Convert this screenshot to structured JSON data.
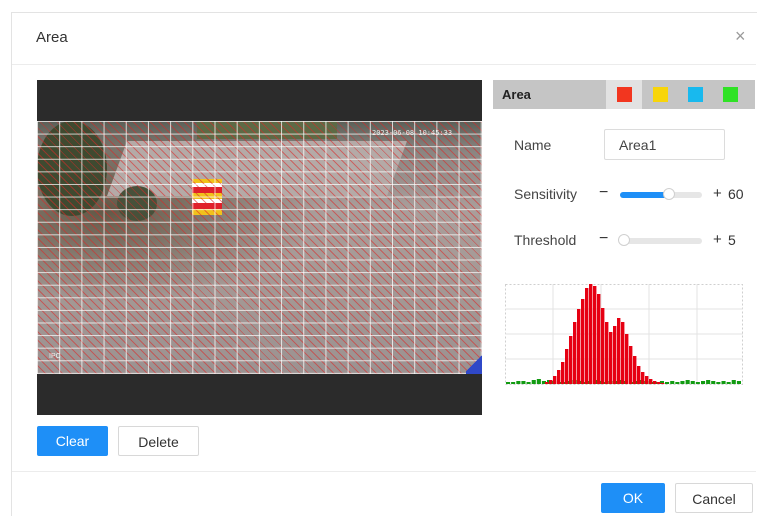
{
  "dialog": {
    "title": "Area",
    "close_glyph": "×"
  },
  "preview": {
    "osd_top_right": "2023-06-08 10:45:33",
    "osd_bottom_left": "IPC"
  },
  "actions": {
    "clear_label": "Clear",
    "delete_label": "Delete"
  },
  "area_panel": {
    "header_label": "Area",
    "colors": [
      {
        "name": "red",
        "hex": "#f2361f",
        "selected": true
      },
      {
        "name": "yellow",
        "hex": "#f8d50a",
        "selected": false
      },
      {
        "name": "blue",
        "hex": "#18b9ee",
        "selected": false
      },
      {
        "name": "green",
        "hex": "#2fe225",
        "selected": false
      }
    ]
  },
  "settings": {
    "name_label": "Name",
    "name_value": "Area1",
    "sensitivity_label": "Sensitivity",
    "sensitivity_value": "60",
    "threshold_label": "Threshold",
    "threshold_value": "5",
    "minus_glyph": "−",
    "plus_glyph": "+"
  },
  "sliders": {
    "sensitivity_fraction": 0.6,
    "threshold_fraction": 0.05
  },
  "histogram": {
    "red_color": "#e60012",
    "green_color": "#129b12",
    "red_bars": [
      0,
      0,
      0,
      2,
      4,
      8,
      14,
      22,
      35,
      48,
      62,
      75,
      85,
      96,
      100,
      98,
      90,
      76,
      62,
      52,
      58,
      66,
      62,
      50,
      38,
      28,
      18,
      12,
      8,
      5,
      3,
      2,
      1,
      0,
      0
    ],
    "green_bars": [
      2,
      2,
      3,
      3,
      2,
      4,
      5,
      3,
      4,
      3,
      2,
      2,
      3,
      4,
      3,
      2,
      3,
      4,
      3,
      2,
      3,
      3,
      4,
      3,
      2,
      3,
      4,
      3,
      2,
      2,
      3,
      2,
      3,
      2,
      3,
      4,
      3,
      2,
      3,
      4,
      3,
      2,
      3,
      2,
      4,
      3
    ]
  },
  "footer": {
    "ok_label": "OK",
    "cancel_label": "Cancel"
  }
}
